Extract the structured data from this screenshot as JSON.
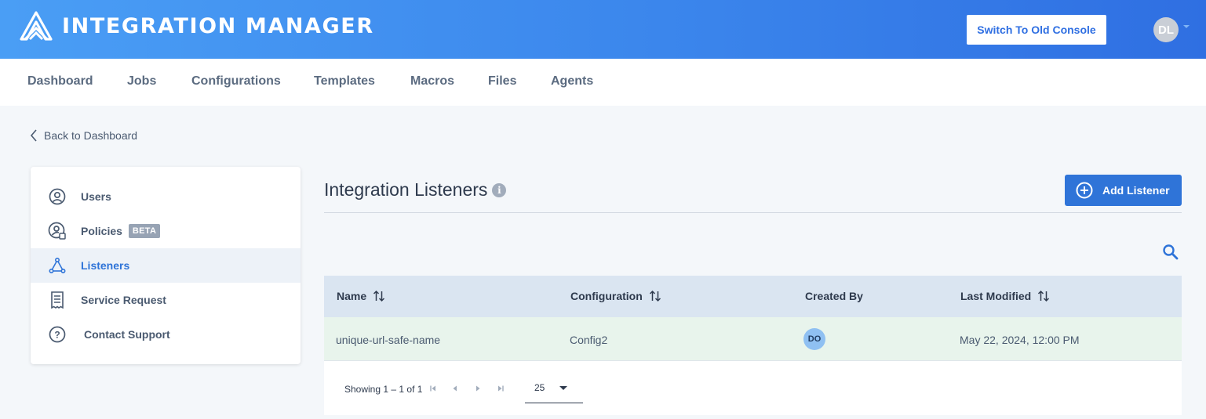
{
  "app": {
    "title": "INTEGRATION MANAGER",
    "logo_icon": "mountain-logo-icon",
    "switch_console_label": "Switch To Old Console",
    "user_initials": "DL",
    "brand_color": "#3b86ec"
  },
  "nav": {
    "items": [
      {
        "label": "Dashboard"
      },
      {
        "label": "Jobs"
      },
      {
        "label": "Configurations"
      },
      {
        "label": "Templates"
      },
      {
        "label": "Macros"
      },
      {
        "label": "Files"
      },
      {
        "label": "Agents"
      }
    ]
  },
  "back_link": {
    "label": "Back to Dashboard",
    "icon": "chevron-left-icon"
  },
  "sidebar": {
    "items": [
      {
        "label": "Users",
        "icon": "user-circle-icon"
      },
      {
        "label": "Policies",
        "icon": "user-shield-icon",
        "badge": "BETA"
      },
      {
        "label": "Listeners",
        "icon": "listener-network-icon",
        "active": true
      },
      {
        "label": "Service Request",
        "icon": "receipt-icon"
      },
      {
        "label": "Contact Support",
        "icon": "help-circle-icon"
      }
    ]
  },
  "main": {
    "title": "Integration Listeners",
    "info_glyph": "i",
    "add_button_label": "Add Listener"
  },
  "table": {
    "columns": [
      {
        "label": "Name",
        "sortable": true
      },
      {
        "label": "Configuration",
        "sortable": true
      },
      {
        "label": "Created By",
        "sortable": false
      },
      {
        "label": "Last Modified",
        "sortable": true
      }
    ],
    "rows": [
      {
        "name": "unique-url-safe-name",
        "configuration": "Config2",
        "created_by": "DO",
        "last_modified": "May 22, 2024, 12:00 PM"
      }
    ],
    "pagination": {
      "showing": "Showing 1 – 1 of 1",
      "page_size": "25"
    }
  }
}
